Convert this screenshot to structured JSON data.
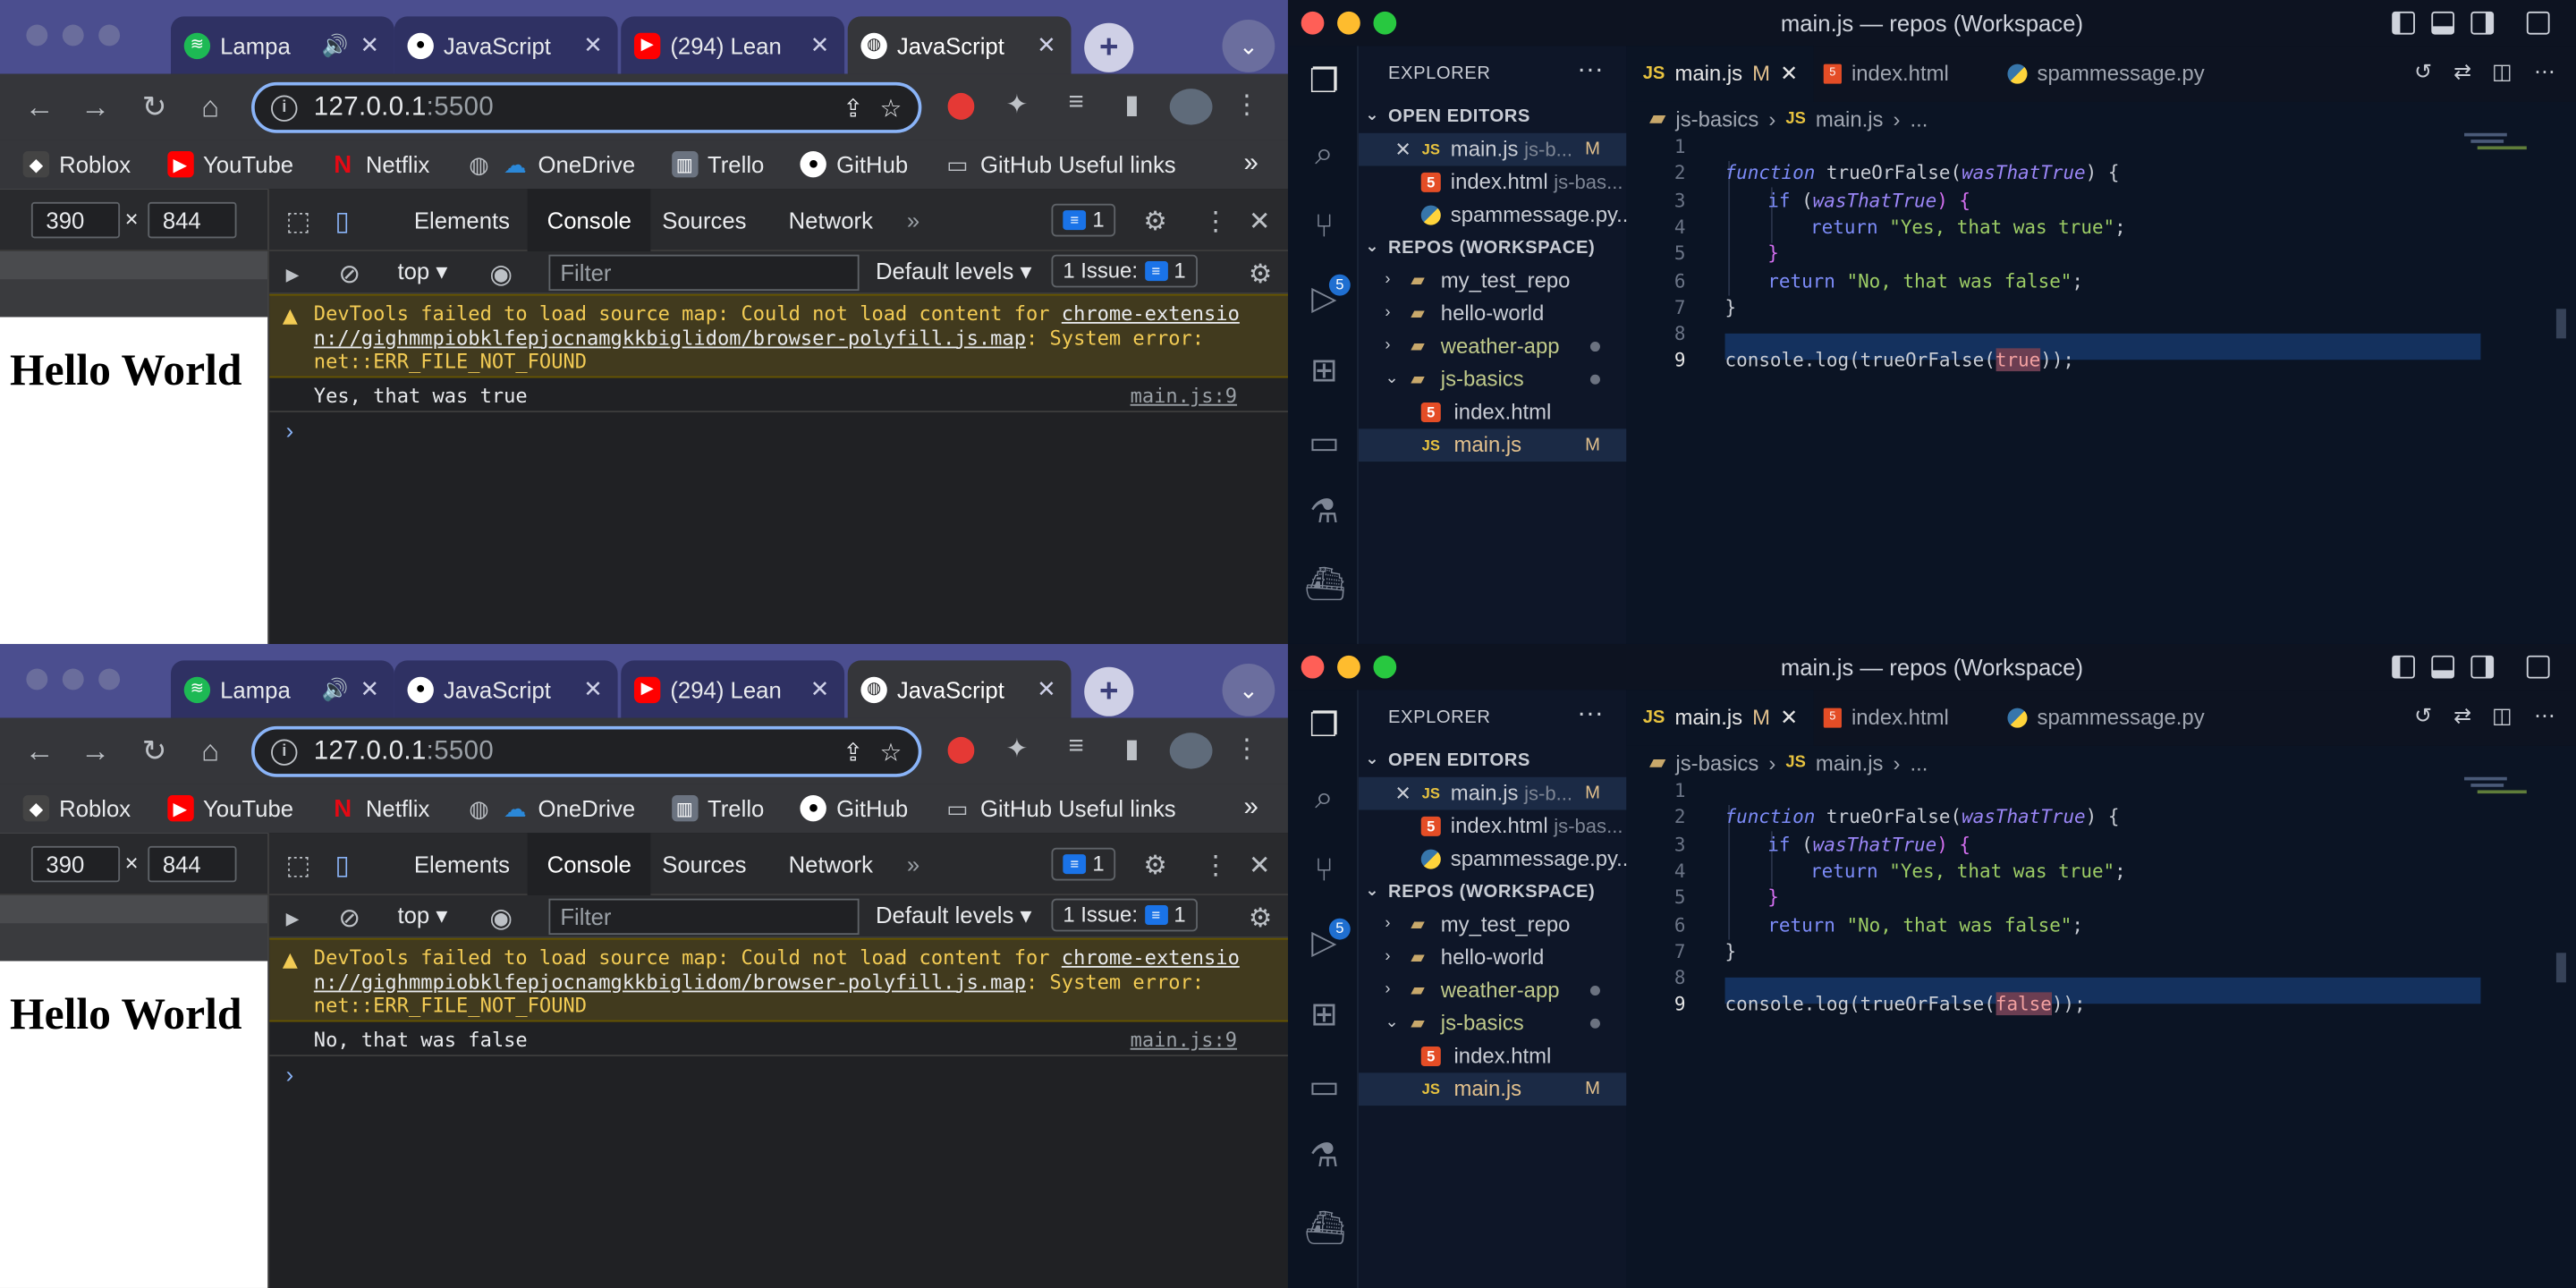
{
  "chrome": {
    "tabs": [
      {
        "title": "Lampa",
        "has_sound": true,
        "favicon": "spotify-icon",
        "color": "#1db954"
      },
      {
        "title": "JavaScript",
        "has_sound": false,
        "favicon": "github-icon",
        "color": "#ffffff"
      },
      {
        "title": "(294) Lean",
        "has_sound": false,
        "favicon": "youtube-icon",
        "color": "#ff0000"
      },
      {
        "title": "JavaScript",
        "has_sound": false,
        "favicon": "globe-icon",
        "color": "#ffffff",
        "active": true
      }
    ],
    "new_tab": "+",
    "url_host": "127.0.0.1",
    "url_port": ":5500",
    "bookmarks": [
      {
        "label": "Roblox",
        "icon": "roblox-icon",
        "color": "#444444"
      },
      {
        "label": "YouTube",
        "icon": "youtube-icon",
        "color": "#ff0000"
      },
      {
        "label": "Netflix",
        "icon": "netflix-icon",
        "color": "#e50914"
      },
      {
        "label": "",
        "icon": "globe-icon",
        "color": "#9aa0a6"
      },
      {
        "label": "OneDrive",
        "icon": "onedrive-icon",
        "color": "#0f78d4"
      },
      {
        "label": "Trello",
        "icon": "trello-icon",
        "color": "#0079bf"
      },
      {
        "label": "GitHub",
        "icon": "github-icon",
        "color": "#ffffff"
      },
      {
        "label": "GitHub Useful links",
        "icon": "folder-icon",
        "color": "#bdc1c6"
      }
    ],
    "bookmarks_more": "»",
    "device_width": "390",
    "device_height": "844",
    "device_x": "×",
    "page_heading": "Hello World",
    "devtools": {
      "tabs": [
        "Elements",
        "Console",
        "Sources",
        "Network"
      ],
      "more": "»",
      "message_count": "1",
      "context": "top",
      "filter_placeholder": "Filter",
      "levels": "Default levels",
      "issues_label": "1 Issue:",
      "issues_count": "1",
      "warning_prefix": "DevTools failed to load source map: Could not load content for ",
      "warning_link1": "chrome-extensio",
      "warning_link2": "n://gighmmpiobklfepjocnamgkkbiglidom/browser-polyfill.js.map",
      "warning_suffix": ": System error:",
      "warning_line3": "net::ERR_FILE_NOT_FOUND",
      "source_ref": "main.js:9",
      "prompt": "›"
    }
  },
  "top_log": "Yes, that was true",
  "bottom_log": "No, that was false",
  "vscode": {
    "title": "main.js — repos (Workspace)",
    "explorer_title": "EXPLORER",
    "explorer_more": "···",
    "open_editors_label": "OPEN EDITORS",
    "open_editors": [
      {
        "name": "main.js",
        "hint": "js-b...",
        "badge": "M",
        "type": "js",
        "close": "×"
      },
      {
        "name": "index.html",
        "hint": "js-bas...",
        "badge": "",
        "type": "html"
      },
      {
        "name": "spammessage.py...",
        "hint": "",
        "badge": "",
        "type": "py"
      }
    ],
    "workspace_label": "REPOS (WORKSPACE)",
    "folders": [
      {
        "name": "my_test_repo",
        "dot": false,
        "color": "#c8ccd4"
      },
      {
        "name": "hello-world",
        "dot": false,
        "color": "#c8ccd4"
      },
      {
        "name": "weather-app",
        "dot": true,
        "color": "#bfc98a"
      },
      {
        "name": "js-basics",
        "dot": true,
        "color": "#bfc98a",
        "open": true
      }
    ],
    "js_basics_files": [
      {
        "name": "index.html",
        "type": "html",
        "badge": ""
      },
      {
        "name": "main.js",
        "type": "js",
        "badge": "M",
        "color": "#e2c08d"
      }
    ],
    "editor_tabs": [
      {
        "name": "main.js",
        "type": "js",
        "modified": "M",
        "active": true
      },
      {
        "name": "index.html",
        "type": "html"
      },
      {
        "name": "spammessage.py",
        "type": "py"
      }
    ],
    "breadcrumb": [
      "js-basics",
      "main.js",
      "..."
    ],
    "breadcrumb_sep": "›",
    "scm_badge": "5",
    "code": {
      "fn_kw": "function",
      "fn_name": " trueOrFalse(",
      "param": "wasThatTrue",
      "fn_open": ") {",
      "if_kw": "if",
      "if_open": " (",
      "if_close": ") {",
      "return_kw": "return",
      "yes_str": "\"Yes, that was true\"",
      "no_str": "\"No, that was false\"",
      "semi": ";",
      "close_brace": "}",
      "console_call": "console.log(trueOrFalse(",
      "call_close": "));"
    },
    "top_arg": "true",
    "bottom_arg": "false",
    "line_numbers": [
      "1",
      "2",
      "3",
      "4",
      "5",
      "6",
      "7",
      "8",
      "9"
    ],
    "colors": {
      "js": "#e8c33f",
      "html": "#e44d26",
      "accent": "#1f6fd1"
    }
  }
}
